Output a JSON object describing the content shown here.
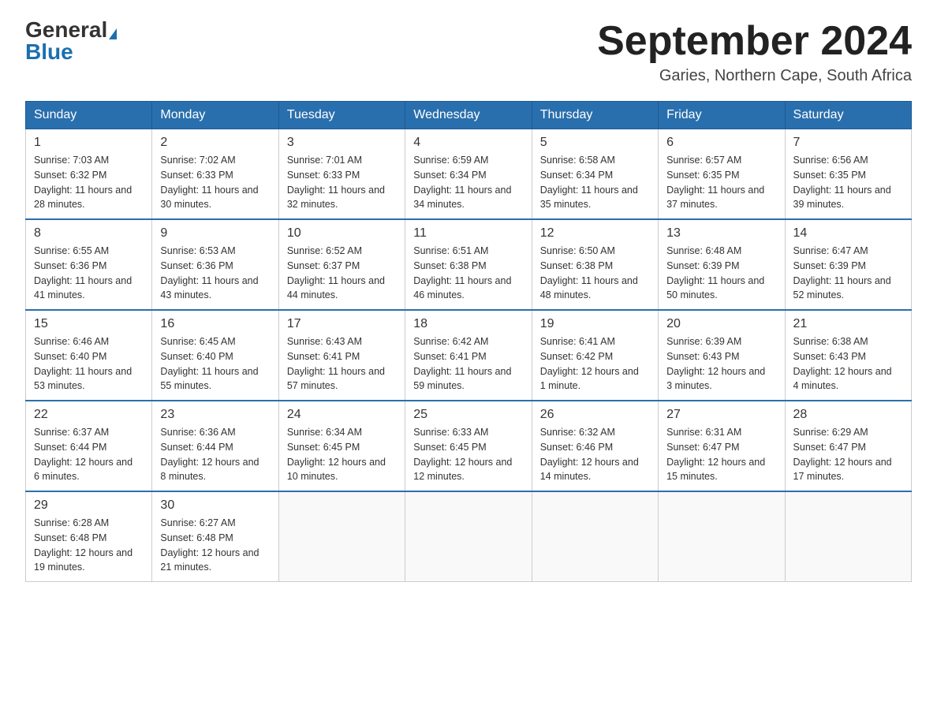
{
  "header": {
    "logo_general": "General",
    "logo_blue": "Blue",
    "month_title": "September 2024",
    "location": "Garies, Northern Cape, South Africa"
  },
  "weekdays": [
    "Sunday",
    "Monday",
    "Tuesday",
    "Wednesday",
    "Thursday",
    "Friday",
    "Saturday"
  ],
  "weeks": [
    [
      {
        "day": "1",
        "sunrise": "7:03 AM",
        "sunset": "6:32 PM",
        "daylight": "11 hours and 28 minutes."
      },
      {
        "day": "2",
        "sunrise": "7:02 AM",
        "sunset": "6:33 PM",
        "daylight": "11 hours and 30 minutes."
      },
      {
        "day": "3",
        "sunrise": "7:01 AM",
        "sunset": "6:33 PM",
        "daylight": "11 hours and 32 minutes."
      },
      {
        "day": "4",
        "sunrise": "6:59 AM",
        "sunset": "6:34 PM",
        "daylight": "11 hours and 34 minutes."
      },
      {
        "day": "5",
        "sunrise": "6:58 AM",
        "sunset": "6:34 PM",
        "daylight": "11 hours and 35 minutes."
      },
      {
        "day": "6",
        "sunrise": "6:57 AM",
        "sunset": "6:35 PM",
        "daylight": "11 hours and 37 minutes."
      },
      {
        "day": "7",
        "sunrise": "6:56 AM",
        "sunset": "6:35 PM",
        "daylight": "11 hours and 39 minutes."
      }
    ],
    [
      {
        "day": "8",
        "sunrise": "6:55 AM",
        "sunset": "6:36 PM",
        "daylight": "11 hours and 41 minutes."
      },
      {
        "day": "9",
        "sunrise": "6:53 AM",
        "sunset": "6:36 PM",
        "daylight": "11 hours and 43 minutes."
      },
      {
        "day": "10",
        "sunrise": "6:52 AM",
        "sunset": "6:37 PM",
        "daylight": "11 hours and 44 minutes."
      },
      {
        "day": "11",
        "sunrise": "6:51 AM",
        "sunset": "6:38 PM",
        "daylight": "11 hours and 46 minutes."
      },
      {
        "day": "12",
        "sunrise": "6:50 AM",
        "sunset": "6:38 PM",
        "daylight": "11 hours and 48 minutes."
      },
      {
        "day": "13",
        "sunrise": "6:48 AM",
        "sunset": "6:39 PM",
        "daylight": "11 hours and 50 minutes."
      },
      {
        "day": "14",
        "sunrise": "6:47 AM",
        "sunset": "6:39 PM",
        "daylight": "11 hours and 52 minutes."
      }
    ],
    [
      {
        "day": "15",
        "sunrise": "6:46 AM",
        "sunset": "6:40 PM",
        "daylight": "11 hours and 53 minutes."
      },
      {
        "day": "16",
        "sunrise": "6:45 AM",
        "sunset": "6:40 PM",
        "daylight": "11 hours and 55 minutes."
      },
      {
        "day": "17",
        "sunrise": "6:43 AM",
        "sunset": "6:41 PM",
        "daylight": "11 hours and 57 minutes."
      },
      {
        "day": "18",
        "sunrise": "6:42 AM",
        "sunset": "6:41 PM",
        "daylight": "11 hours and 59 minutes."
      },
      {
        "day": "19",
        "sunrise": "6:41 AM",
        "sunset": "6:42 PM",
        "daylight": "12 hours and 1 minute."
      },
      {
        "day": "20",
        "sunrise": "6:39 AM",
        "sunset": "6:43 PM",
        "daylight": "12 hours and 3 minutes."
      },
      {
        "day": "21",
        "sunrise": "6:38 AM",
        "sunset": "6:43 PM",
        "daylight": "12 hours and 4 minutes."
      }
    ],
    [
      {
        "day": "22",
        "sunrise": "6:37 AM",
        "sunset": "6:44 PM",
        "daylight": "12 hours and 6 minutes."
      },
      {
        "day": "23",
        "sunrise": "6:36 AM",
        "sunset": "6:44 PM",
        "daylight": "12 hours and 8 minutes."
      },
      {
        "day": "24",
        "sunrise": "6:34 AM",
        "sunset": "6:45 PM",
        "daylight": "12 hours and 10 minutes."
      },
      {
        "day": "25",
        "sunrise": "6:33 AM",
        "sunset": "6:45 PM",
        "daylight": "12 hours and 12 minutes."
      },
      {
        "day": "26",
        "sunrise": "6:32 AM",
        "sunset": "6:46 PM",
        "daylight": "12 hours and 14 minutes."
      },
      {
        "day": "27",
        "sunrise": "6:31 AM",
        "sunset": "6:47 PM",
        "daylight": "12 hours and 15 minutes."
      },
      {
        "day": "28",
        "sunrise": "6:29 AM",
        "sunset": "6:47 PM",
        "daylight": "12 hours and 17 minutes."
      }
    ],
    [
      {
        "day": "29",
        "sunrise": "6:28 AM",
        "sunset": "6:48 PM",
        "daylight": "12 hours and 19 minutes."
      },
      {
        "day": "30",
        "sunrise": "6:27 AM",
        "sunset": "6:48 PM",
        "daylight": "12 hours and 21 minutes."
      },
      null,
      null,
      null,
      null,
      null
    ]
  ],
  "labels": {
    "sunrise": "Sunrise:",
    "sunset": "Sunset:",
    "daylight": "Daylight:"
  }
}
